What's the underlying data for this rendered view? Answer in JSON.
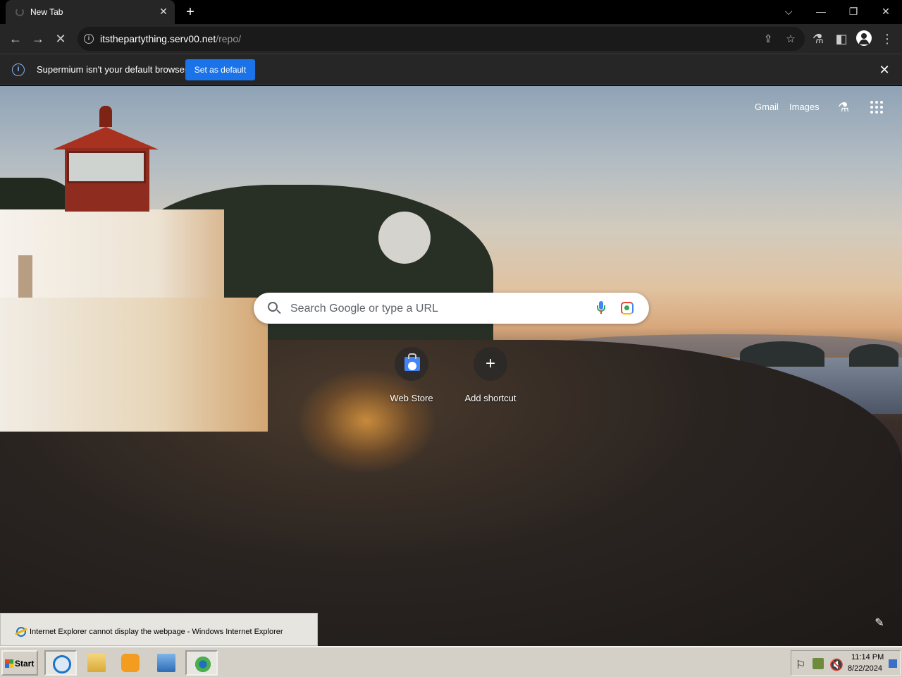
{
  "browser": {
    "tab_title": "New Tab",
    "tab_close": "✕",
    "new_tab": "+",
    "url_host": "itsthepartything.serv00.net",
    "url_path": "/repo/"
  },
  "infobar": {
    "message": "Supermium isn't your default browser",
    "button": "Set as default",
    "close": "✕"
  },
  "ntp": {
    "links": {
      "gmail": "Gmail",
      "images": "Images"
    },
    "search_placeholder": "Search Google or type a URL",
    "shortcuts": [
      {
        "label": "Web Store",
        "icon": "web-store-icon"
      },
      {
        "label": "Add shortcut",
        "icon": "plus-icon"
      }
    ]
  },
  "ie_window": {
    "title": "Internet Explorer cannot display the webpage - Windows Internet Explorer"
  },
  "taskbar": {
    "start_label": "Start",
    "clock_time": "11:14 PM",
    "clock_date": "8/22/2024"
  },
  "colors": {
    "infobar_button": "#1a73e8",
    "toolbar": "#262626",
    "taskbar": "#d4d0c8"
  }
}
